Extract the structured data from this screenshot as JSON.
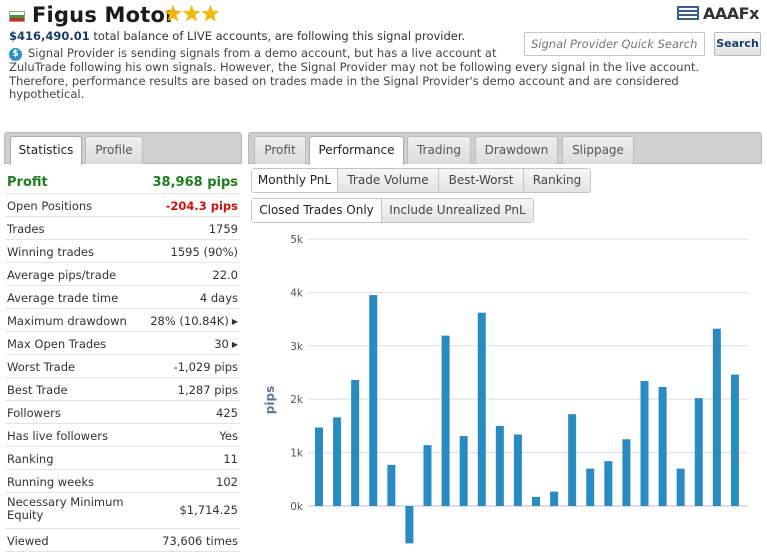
{
  "header": {
    "title": "Figus Motor",
    "stars": "★★★",
    "balance_amount": "$416,490.01",
    "balance_text": "total balance of LIVE accounts, are following this signal provider.",
    "demo_notice_line1": "Signal Provider is sending signals from a demo account, but has a live account at",
    "demo_notice_line2": "ZuluTrade following his own signals. However, the Signal Provider may not be following every signal in the live account. Therefore, performance results are based on trades made in the Signal Provider's demo account and are considered hypothetical.",
    "demo_icon": "$",
    "logo_text": "AAAFx",
    "search_placeholder": "Signal Provider Quick Search",
    "search_button": "Search"
  },
  "colors": {
    "accent_blue": "#2a8ac2",
    "profit_green": "#1e7e1e",
    "loss_red": "#cc1111",
    "star_gold": "#f2b900"
  },
  "left_tabs": [
    "Statistics",
    "Profile"
  ],
  "right_tabs": [
    "Profit",
    "Performance",
    "Trading",
    "Drawdown",
    "Slippage"
  ],
  "sub_tabs_1": [
    "Monthly PnL",
    "Trade Volume",
    "Best-Worst",
    "Ranking"
  ],
  "sub_tabs_2": [
    "Closed Trades Only",
    "Include Unrealized PnL"
  ],
  "stats": [
    {
      "label": "Profit",
      "value": "38,968 pips"
    },
    {
      "label": "Open Positions",
      "value": "-204.3 pips"
    },
    {
      "label": "Trades",
      "value": "1759"
    },
    {
      "label": "Winning trades",
      "value": "1595 (90%)"
    },
    {
      "label": "Average pips/trade",
      "value": "22.0"
    },
    {
      "label": "Average trade time",
      "value": "4 days"
    },
    {
      "label": "Maximum drawdown",
      "value": "28% (10.84K)"
    },
    {
      "label": "Max Open Trades",
      "value": "30"
    },
    {
      "label": "Worst Trade",
      "value": "-1,029 pips"
    },
    {
      "label": "Best Trade",
      "value": "1,287 pips"
    },
    {
      "label": "Followers",
      "value": "425"
    },
    {
      "label": "Has live followers",
      "value": "Yes"
    },
    {
      "label": "Ranking",
      "value": "11"
    },
    {
      "label": "Running weeks",
      "value": "102"
    },
    {
      "label": "Necessary Minimum Equity",
      "value": "$1,714.25"
    },
    {
      "label": "Viewed",
      "value": "73,606 times"
    }
  ],
  "chart_data": {
    "type": "bar",
    "ylabel": "pips",
    "yticks": [
      "0k",
      "1k",
      "2k",
      "3k",
      "4k",
      "5k"
    ],
    "ylim": [
      -700,
      5000
    ],
    "grid": true,
    "color": "#2a8ac2",
    "values": [
      1470,
      1660,
      2360,
      3950,
      770,
      -700,
      1140,
      3190,
      1310,
      3620,
      1500,
      1340,
      170,
      270,
      1720,
      700,
      840,
      1250,
      2340,
      2230,
      700,
      2020,
      3320,
      2460
    ]
  }
}
